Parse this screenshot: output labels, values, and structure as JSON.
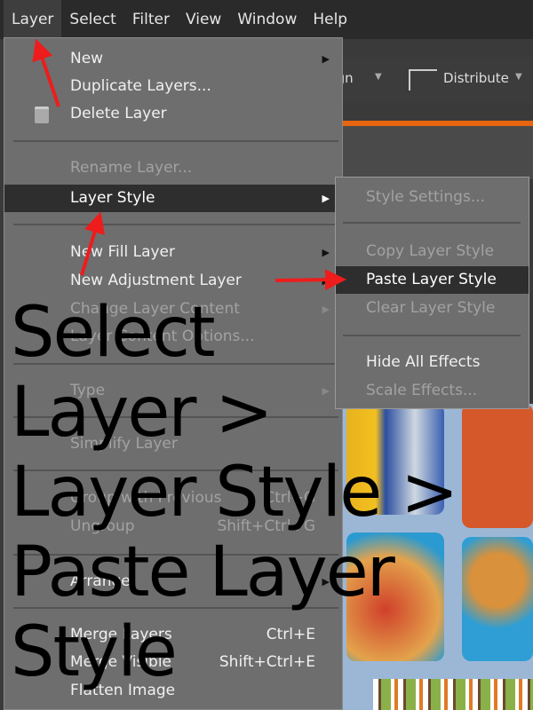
{
  "menubar": [
    "Layer",
    "Select",
    "Filter",
    "View",
    "Window",
    "Help"
  ],
  "toolbar": {
    "align": "Align",
    "distribute": "Distribute"
  },
  "menu": [
    {
      "label": "New",
      "submenu": true
    },
    {
      "label": "Duplicate Layers..."
    },
    {
      "label": "Delete Layer",
      "icon": "trash-icon"
    },
    {
      "label": "Rename Layer...",
      "disabled": true
    },
    {
      "label": "Layer Style",
      "submenu": true,
      "highlighted": true
    },
    {
      "label": "New Fill Layer",
      "submenu": true
    },
    {
      "label": "New Adjustment Layer",
      "submenu": true
    },
    {
      "label": "Change Layer Content",
      "submenu": true,
      "disabled": true
    },
    {
      "label": "Layer Content Options...",
      "disabled": true
    },
    {
      "label": "Type",
      "submenu": true,
      "disabled": true
    },
    {
      "label": "Simplify Layer",
      "disabled": true
    },
    {
      "label": "Group with Previous",
      "shortcut": "Ctrl+G",
      "disabled": true
    },
    {
      "label": "Ungroup",
      "shortcut": "Shift+Ctrl+G",
      "disabled": true
    },
    {
      "label": "Arrange",
      "submenu": true
    },
    {
      "label": "Merge Layers",
      "shortcut": "Ctrl+E"
    },
    {
      "label": "Merge Visible",
      "shortcut": "Shift+Ctrl+E"
    },
    {
      "label": "Flatten Image"
    }
  ],
  "submenu": [
    {
      "label": "Style Settings...",
      "disabled": true
    },
    {
      "label": "Copy Layer Style",
      "disabled": true
    },
    {
      "label": "Paste Layer Style",
      "highlighted": true
    },
    {
      "label": "Clear Layer Style",
      "disabled": true
    },
    {
      "label": "Hide All Effects"
    },
    {
      "label": "Scale Effects...",
      "disabled": true
    }
  ],
  "overlay": [
    "Select",
    "Layer >",
    "Layer Style >",
    "Paste Layer",
    "Style"
  ],
  "colors": {
    "arrow": "#ee1c1c",
    "highlight": "#2e2e2e",
    "accent": "#e8650f"
  }
}
